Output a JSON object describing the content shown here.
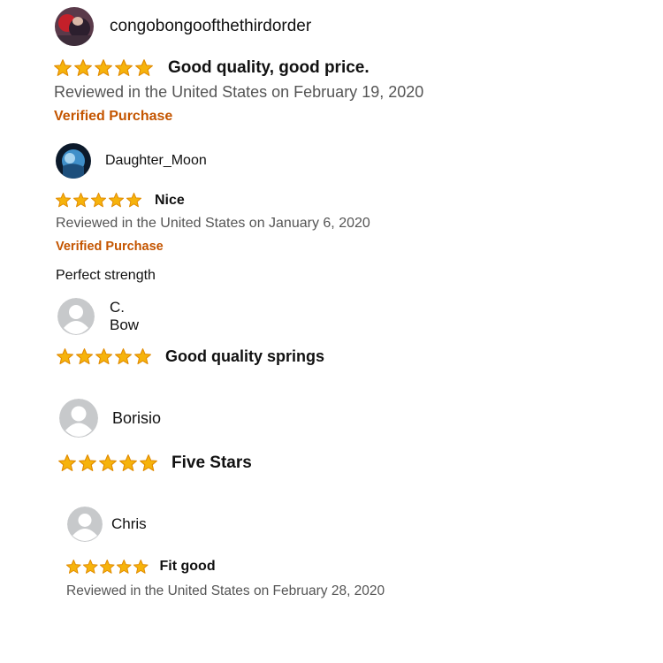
{
  "colors": {
    "star": "#f6b30c",
    "star_stroke": "#e08a00",
    "verified": "#c45500",
    "meta": "#555555"
  },
  "reviews": [
    {
      "profile_name": "congobongoofthethirdorder",
      "avatar_icon": "photo-avatar-icon",
      "rating": 5,
      "title": "Good quality, good price.",
      "date_line": "Reviewed in the United States on February 19, 2020",
      "badge": "Verified Purchase",
      "body": ""
    },
    {
      "profile_name": "Daughter_Moon",
      "avatar_icon": "photo-avatar-icon",
      "rating": 5,
      "title": "Nice",
      "date_line": "Reviewed in the United States on January 6, 2020",
      "badge": "Verified Purchase",
      "body": "Perfect strength"
    },
    {
      "profile_name": "C. Bow",
      "avatar_icon": "default-user-icon",
      "rating": 5,
      "title": "Good quality springs",
      "date_line": "",
      "badge": "",
      "body": ""
    },
    {
      "profile_name": "Borisio",
      "avatar_icon": "default-user-icon",
      "rating": 5,
      "title": "Five Stars",
      "date_line": "",
      "badge": "",
      "body": ""
    },
    {
      "profile_name": "Chris",
      "avatar_icon": "default-user-icon",
      "rating": 5,
      "title": "Fit good",
      "date_line": "Reviewed in the United States on February 28, 2020",
      "badge": "",
      "body": ""
    }
  ]
}
